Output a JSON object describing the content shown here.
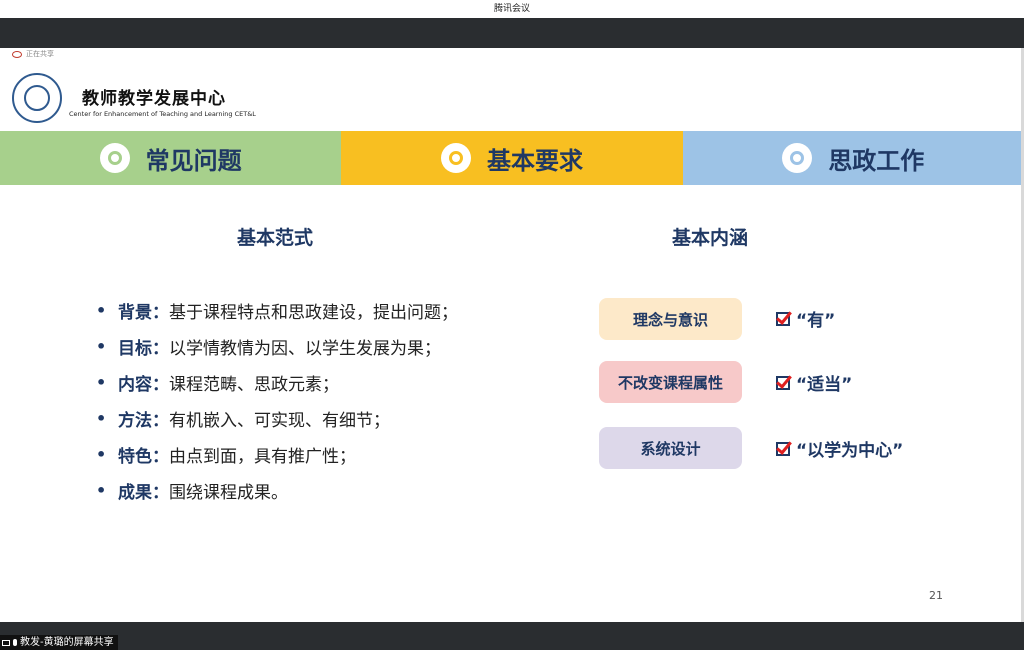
{
  "window": {
    "title": "腾讯会议"
  },
  "share_indicator": {
    "label": "正在共享"
  },
  "slide": {
    "org_title": "教师教学发展中心",
    "org_subtitle": "Center for Enhancement of Teaching and Learning CET&L",
    "tabs": [
      {
        "label": "常见问题",
        "color": "#a7d08c",
        "icon": "shutter-icon"
      },
      {
        "label": "基本要求",
        "color": "#f8bf21",
        "icon": "shutter-icon"
      },
      {
        "label": "思政工作",
        "color": "#9dc3e6",
        "icon": "shutter-icon"
      }
    ],
    "left_heading": "基本范式",
    "right_heading": "基本内涵",
    "bullets": [
      {
        "key": "背景：",
        "value": "基于课程特点和思政建设，提出问题；"
      },
      {
        "key": "目标：",
        "value": "以学情教情为因、以学生发展为果；"
      },
      {
        "key": "内容：",
        "value": "课程范畴、思政元素；"
      },
      {
        "key": "方法：",
        "value": "有机嵌入、可实现、有细节；"
      },
      {
        "key": "特色：",
        "value": "由点到面，具有推广性；"
      },
      {
        "key": "成果：",
        "value": "围绕课程成果。"
      }
    ],
    "bullet_marker": "•",
    "connotations": [
      {
        "box": "理念与意识",
        "check": "“有”",
        "color": "#fde9c9"
      },
      {
        "box": "不改变课程属性",
        "check": "“适当”",
        "color": "#f7c9c9"
      },
      {
        "box": "系统设计",
        "check": "“以学为中心”",
        "color": "#ddd8ea"
      }
    ],
    "page_number": "21"
  },
  "bottom_bar": {
    "share_label": "教发-黄璐的屏幕共享"
  }
}
